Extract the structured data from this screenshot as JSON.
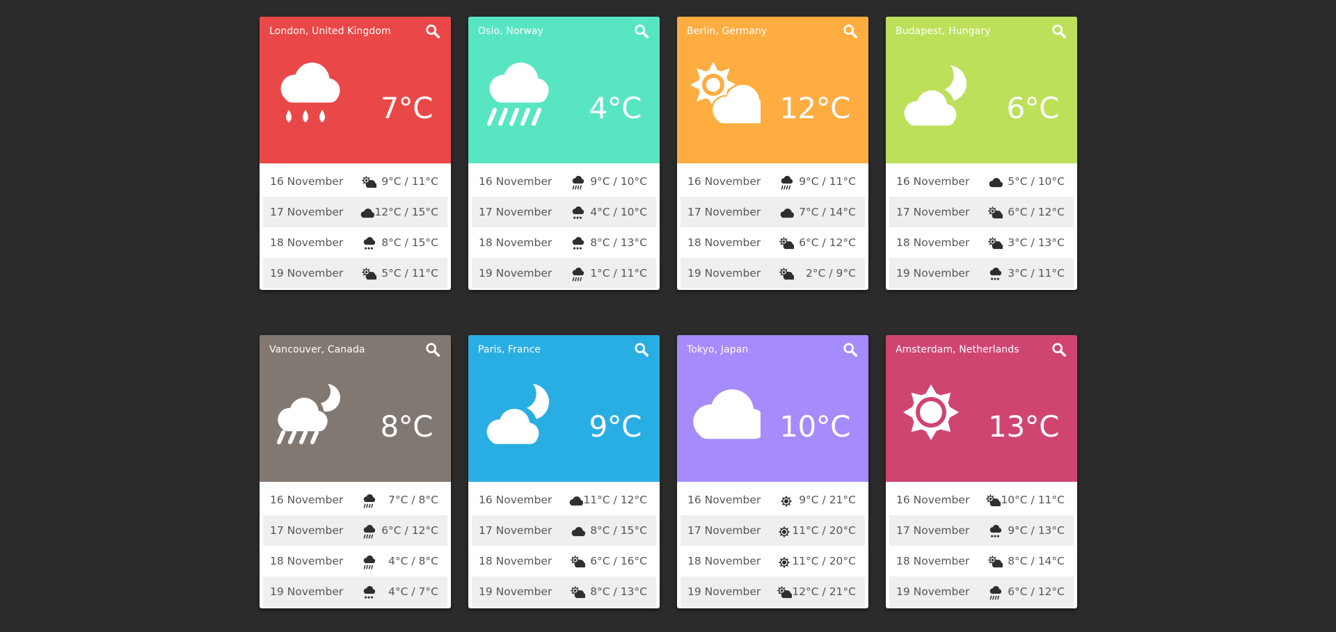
{
  "cards": [
    {
      "city": "London, United Kingdom",
      "temp": "7°C",
      "color": "#ea4848",
      "icon": "rain-icon",
      "forecast": [
        {
          "date": "16 November",
          "icon": "partly-cloudy-icon",
          "range": "9°C / 11°C"
        },
        {
          "date": "17 November",
          "icon": "cloud-icon",
          "range": "12°C / 15°C"
        },
        {
          "date": "18 November",
          "icon": "rain-icon",
          "range": "8°C / 15°C"
        },
        {
          "date": "19 November",
          "icon": "partly-cloudy-icon",
          "range": "5°C / 11°C"
        }
      ]
    },
    {
      "city": "Oslo, Norway",
      "temp": "4°C",
      "color": "#58e5c2",
      "icon": "drizzle-icon",
      "forecast": [
        {
          "date": "16 November",
          "icon": "drizzle-icon",
          "range": "9°C / 10°C"
        },
        {
          "date": "17 November",
          "icon": "rain-icon",
          "range": "4°C / 10°C"
        },
        {
          "date": "18 November",
          "icon": "rain-icon",
          "range": "8°C / 13°C"
        },
        {
          "date": "19 November",
          "icon": "drizzle-icon",
          "range": "1°C / 11°C"
        }
      ]
    },
    {
      "city": "Berlin, Germany",
      "temp": "12°C",
      "color": "#ffad41",
      "icon": "partly-cloudy-icon",
      "forecast": [
        {
          "date": "16 November",
          "icon": "drizzle-icon",
          "range": "9°C / 11°C"
        },
        {
          "date": "17 November",
          "icon": "cloud-icon",
          "range": "7°C / 14°C"
        },
        {
          "date": "18 November",
          "icon": "partly-cloudy-icon",
          "range": "6°C / 12°C"
        },
        {
          "date": "19 November",
          "icon": "partly-cloudy-icon",
          "range": "2°C / 9°C"
        }
      ]
    },
    {
      "city": "Budapest, Hungary",
      "temp": "6°C",
      "color": "#bde05b",
      "icon": "moon-cloud-icon",
      "forecast": [
        {
          "date": "16 November",
          "icon": "cloud-icon",
          "range": "5°C / 10°C"
        },
        {
          "date": "17 November",
          "icon": "partly-cloudy-icon",
          "range": "6°C / 12°C"
        },
        {
          "date": "18 November",
          "icon": "partly-cloudy-icon",
          "range": "3°C / 13°C"
        },
        {
          "date": "19 November",
          "icon": "rain-icon",
          "range": "3°C / 11°C"
        }
      ]
    },
    {
      "city": "Vancouver, Canada",
      "temp": "8°C",
      "color": "#827872",
      "icon": "moon-cloud-rain-icon",
      "forecast": [
        {
          "date": "16 November",
          "icon": "drizzle-icon",
          "range": "7°C / 8°C"
        },
        {
          "date": "17 November",
          "icon": "drizzle-icon",
          "range": "6°C / 12°C"
        },
        {
          "date": "18 November",
          "icon": "drizzle-icon",
          "range": "4°C / 8°C"
        },
        {
          "date": "19 November",
          "icon": "rain-icon",
          "range": "4°C / 7°C"
        }
      ]
    },
    {
      "city": "Paris, France",
      "temp": "9°C",
      "color": "#29aee3",
      "icon": "moon-cloud-icon",
      "forecast": [
        {
          "date": "16 November",
          "icon": "cloud-icon",
          "range": "11°C / 12°C"
        },
        {
          "date": "17 November",
          "icon": "cloud-icon",
          "range": "8°C / 15°C"
        },
        {
          "date": "18 November",
          "icon": "partly-cloudy-icon",
          "range": "6°C / 16°C"
        },
        {
          "date": "19 November",
          "icon": "partly-cloudy-icon",
          "range": "8°C / 13°C"
        }
      ]
    },
    {
      "city": "Tokyo, Japan",
      "temp": "10°C",
      "color": "#a58bfb",
      "icon": "cloud-icon",
      "forecast": [
        {
          "date": "16 November",
          "icon": "sun-icon",
          "range": "9°C / 21°C"
        },
        {
          "date": "17 November",
          "icon": "sun-icon",
          "range": "11°C / 20°C"
        },
        {
          "date": "18 November",
          "icon": "sun-icon",
          "range": "11°C / 20°C"
        },
        {
          "date": "19 November",
          "icon": "partly-cloudy-icon",
          "range": "12°C / 21°C"
        }
      ]
    },
    {
      "city": "Amsterdam, Netherlands",
      "temp": "13°C",
      "color": "#cf4570",
      "icon": "sun-icon",
      "forecast": [
        {
          "date": "16 November",
          "icon": "partly-cloudy-icon",
          "range": "10°C / 11°C"
        },
        {
          "date": "17 November",
          "icon": "rain-icon",
          "range": "9°C / 13°C"
        },
        {
          "date": "18 November",
          "icon": "partly-cloudy-icon",
          "range": "8°C / 14°C"
        },
        {
          "date": "19 November",
          "icon": "drizzle-icon",
          "range": "6°C / 12°C"
        }
      ]
    }
  ]
}
